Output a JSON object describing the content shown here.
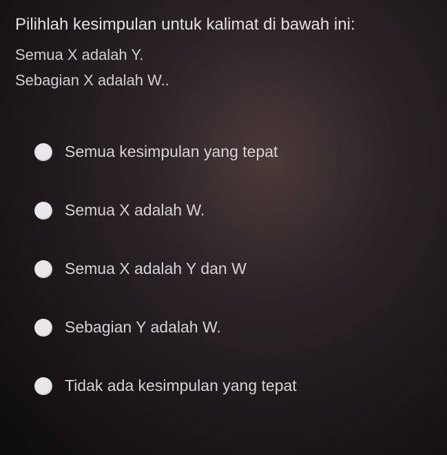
{
  "question": {
    "prompt": "Pilihlah kesimpulan untuk kalimat di bawah ini:",
    "premise1": "Semua X adalah Y.",
    "premise2": "Sebagian X adalah W.."
  },
  "options": [
    {
      "label": "Semua kesimpulan yang tepat"
    },
    {
      "label": "Semua X adalah W."
    },
    {
      "label": "Semua X adalah Y dan W"
    },
    {
      "label": "Sebagian Y adalah W."
    },
    {
      "label": "Tidak ada kesimpulan yang tepat"
    }
  ]
}
